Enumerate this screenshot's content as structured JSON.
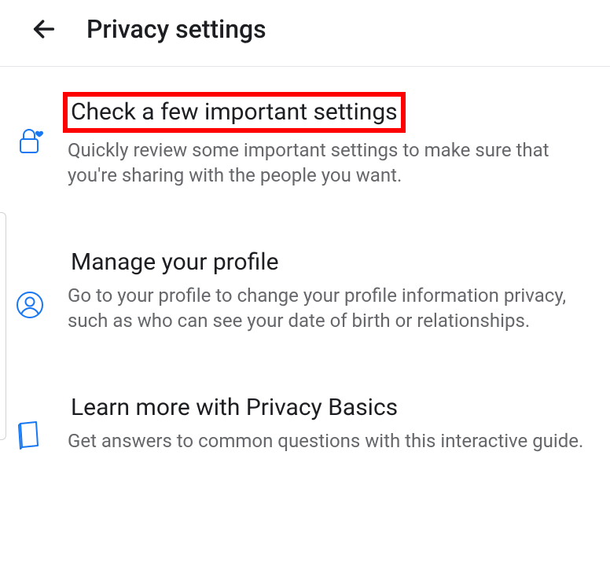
{
  "header": {
    "title": "Privacy settings"
  },
  "items": [
    {
      "title": "Check a few important settings",
      "sub": "Quickly review some important settings to make sure that you're sharing with the people you want.",
      "highlighted": true,
      "icon": "lock-heart-icon"
    },
    {
      "title": "Manage your profile",
      "sub": "Go to your profile to change your profile information privacy, such as who can see your date of birth or relationships.",
      "highlighted": false,
      "icon": "profile-icon"
    },
    {
      "title": "Learn more with Privacy Basics",
      "sub": "Get answers to common questions with this interactive guide.",
      "highlighted": false,
      "icon": "book-icon"
    }
  ],
  "colors": {
    "icon_blue": "#1877f2",
    "text_primary": "#1c1e21",
    "text_secondary": "#65676b",
    "highlight_border": "#ff0000"
  }
}
